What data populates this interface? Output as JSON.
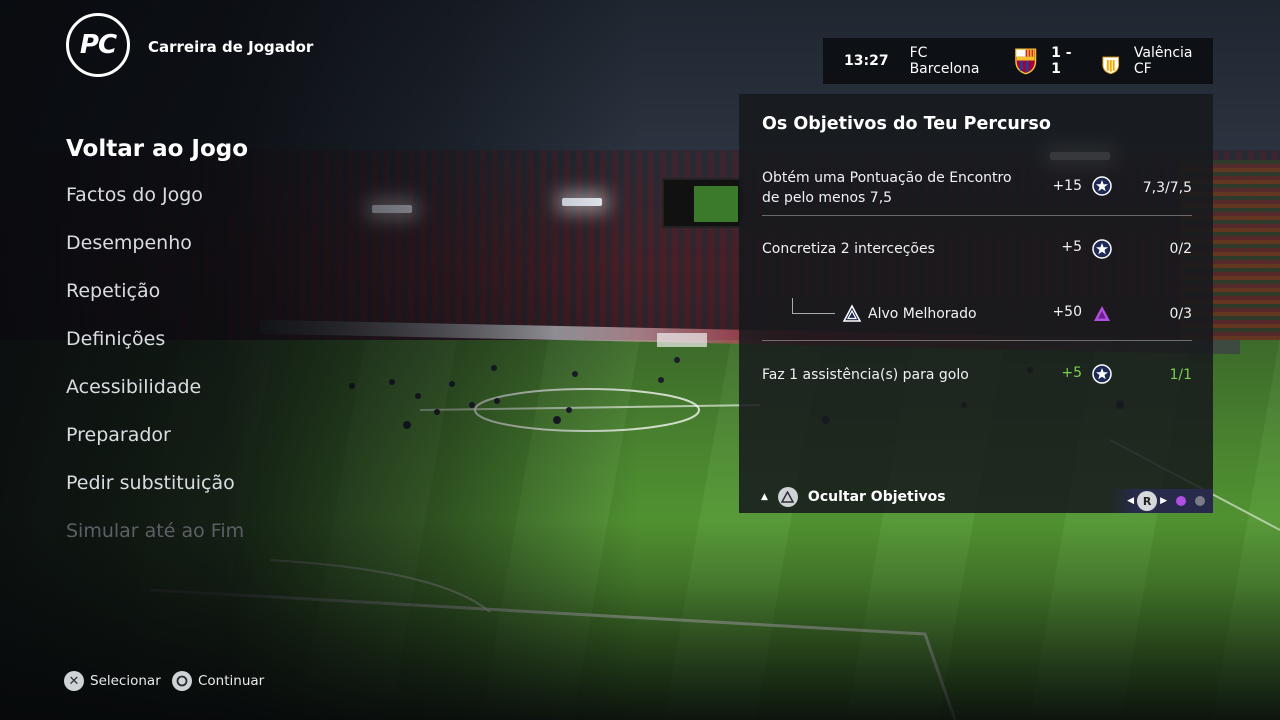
{
  "header": {
    "logo_text": "PC",
    "mode_title": "Carreira de Jogador"
  },
  "menu": {
    "items": [
      {
        "label": "Voltar ao Jogo",
        "state": "active"
      },
      {
        "label": "Factos do Jogo",
        "state": "normal"
      },
      {
        "label": "Desempenho",
        "state": "normal"
      },
      {
        "label": "Repetição",
        "state": "normal"
      },
      {
        "label": "Definições",
        "state": "normal"
      },
      {
        "label": "Acessibilidade",
        "state": "normal"
      },
      {
        "label": "Preparador",
        "state": "normal"
      },
      {
        "label": "Pedir substituição",
        "state": "normal"
      },
      {
        "label": "Simular até ao Fim",
        "state": "disabled"
      }
    ]
  },
  "footer": {
    "select_label": "Selecionar",
    "select_icon": "cross-button-icon",
    "continue_label": "Continuar",
    "continue_icon": "circle-button-icon"
  },
  "scoreboard": {
    "time": "13:27",
    "home_team": "FC Barcelona",
    "score": "1 - 1",
    "away_team": "Valência CF"
  },
  "objectives": {
    "title": "Os Objetivos do Teu Percurso",
    "rows": [
      {
        "text": "Obtém uma Pontuação de Encontro de pelo menos 7,5",
        "points": "+15",
        "icon": "star-icon",
        "progress": "7,3/7,5",
        "completed": false
      },
      {
        "text": "Concretiza 2 interceções",
        "points": "+5",
        "icon": "star-icon",
        "progress": "0/2",
        "completed": false
      },
      {
        "text": "Alvo Melhorado",
        "points": "+50",
        "icon": "purple-badge-icon",
        "progress": "0/3",
        "completed": false,
        "sub": true
      },
      {
        "text": "Faz 1 assistência(s) para golo",
        "points": "+5",
        "icon": "star-icon",
        "progress": "1/1",
        "completed": true
      }
    ],
    "toggle_label": "Ocultar Objetivos",
    "pager_button": "R",
    "pages": 2,
    "current_page": 1
  },
  "colors": {
    "completed_green": "#79d14f",
    "page_active": "#b04fe0",
    "page_inactive": "#7a7d86"
  }
}
